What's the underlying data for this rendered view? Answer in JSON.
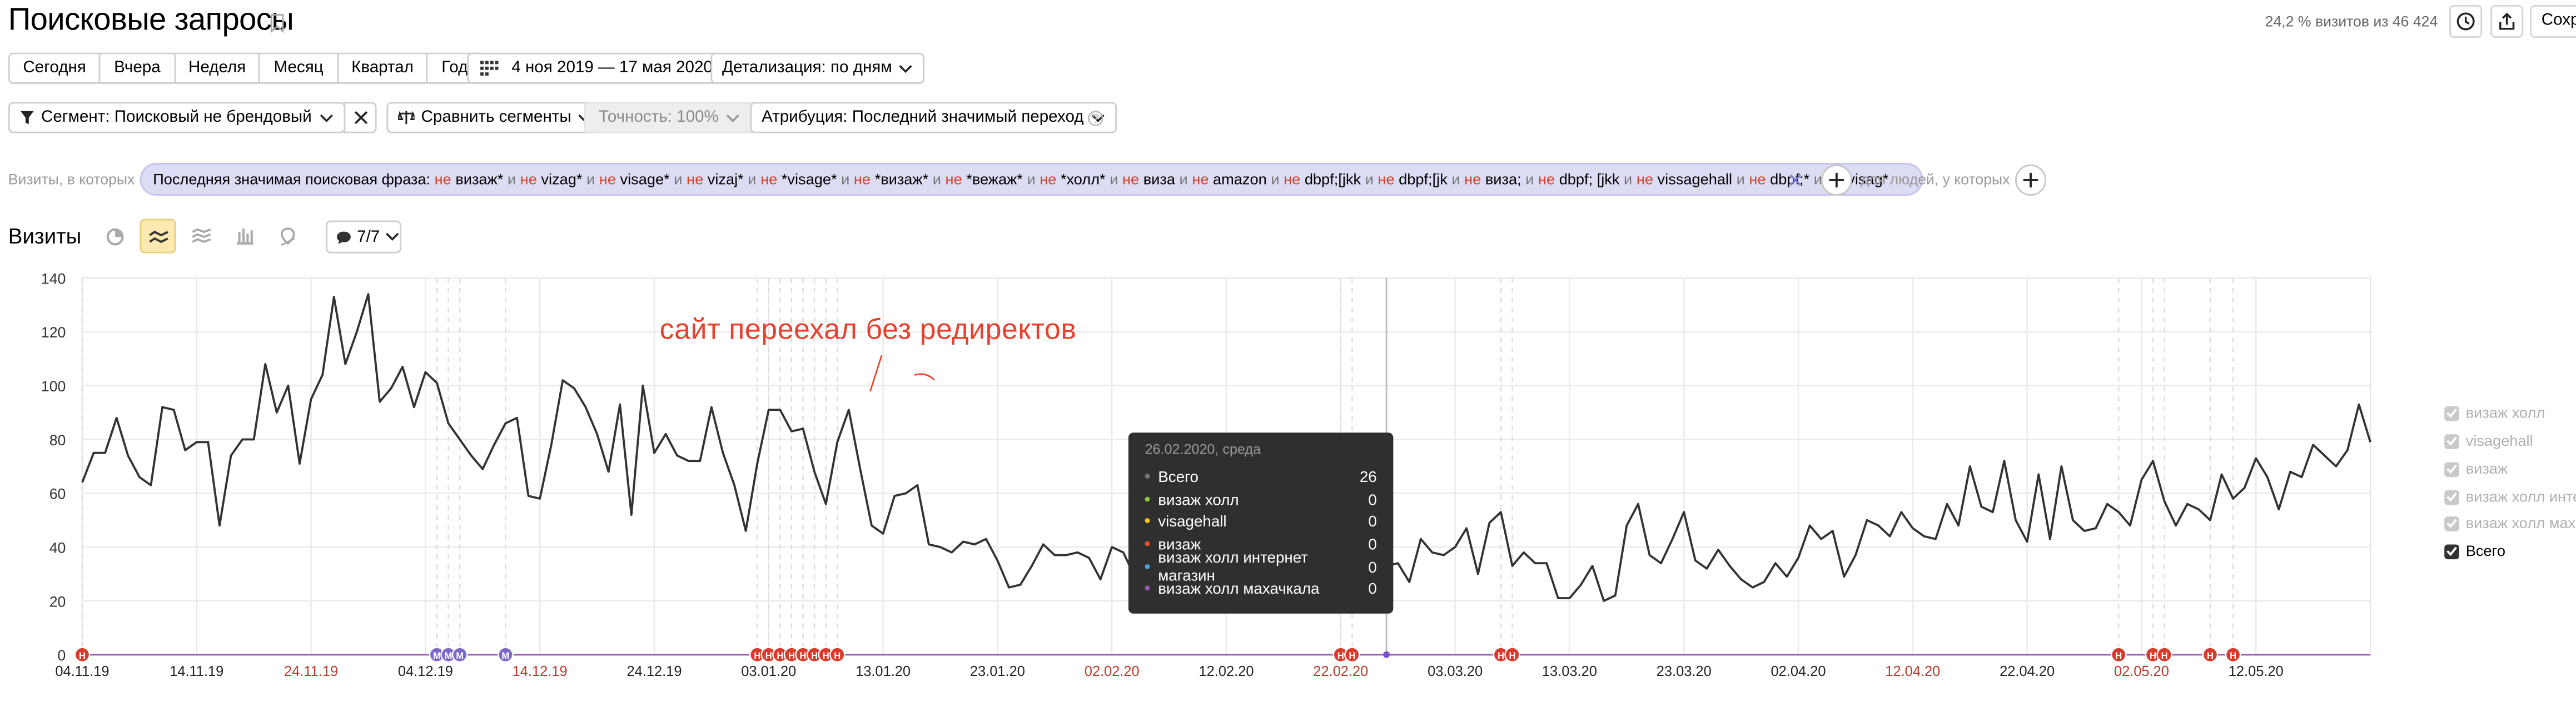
{
  "header": {
    "title": "Поисковые запросы",
    "visits_info": "24,2 % визитов из 46 424",
    "save_label": "Сохр"
  },
  "period": {
    "buttons": [
      "Сегодня",
      "Вчера",
      "Неделя",
      "Месяц",
      "Квартал",
      "Год"
    ],
    "date_range": "4 ноя 2019 — 17 мая 2020",
    "detail": "Детализация: по дням"
  },
  "filters": {
    "segment": "Сегмент: Поисковый не брендовый тр...",
    "compare": "Сравнить сегменты",
    "accuracy": "Точность: 100%",
    "attribution": "Атрибуция: Последний значимый переход"
  },
  "conditions": {
    "label": "Визиты, в которых",
    "people_label": "для людей, у которых",
    "pill_parts": [
      {
        "t": "Последняя значимая поисковая фраза: ",
        "c": ""
      },
      {
        "t": "не",
        "c": "n"
      },
      {
        "t": " визаж* ",
        "c": ""
      },
      {
        "t": "и",
        "c": "g"
      },
      {
        "t": " ",
        "c": ""
      },
      {
        "t": "не",
        "c": "n"
      },
      {
        "t": " vizag* ",
        "c": ""
      },
      {
        "t": "и",
        "c": "g"
      },
      {
        "t": " ",
        "c": ""
      },
      {
        "t": "не",
        "c": "n"
      },
      {
        "t": " visage* ",
        "c": ""
      },
      {
        "t": "и",
        "c": "g"
      },
      {
        "t": " ",
        "c": ""
      },
      {
        "t": "не",
        "c": "n"
      },
      {
        "t": " vizaj* ",
        "c": ""
      },
      {
        "t": "и",
        "c": "g"
      },
      {
        "t": " ",
        "c": ""
      },
      {
        "t": "не",
        "c": "n"
      },
      {
        "t": " *visage* ",
        "c": ""
      },
      {
        "t": "и",
        "c": "g"
      },
      {
        "t": " ",
        "c": ""
      },
      {
        "t": "не",
        "c": "n"
      },
      {
        "t": " *визаж* ",
        "c": ""
      },
      {
        "t": "и",
        "c": "g"
      },
      {
        "t": " ",
        "c": ""
      },
      {
        "t": "не",
        "c": "n"
      },
      {
        "t": " *вежаж* ",
        "c": ""
      },
      {
        "t": "и",
        "c": "g"
      },
      {
        "t": " ",
        "c": ""
      },
      {
        "t": "не",
        "c": "n"
      },
      {
        "t": " *холл* ",
        "c": ""
      },
      {
        "t": "и",
        "c": "g"
      },
      {
        "t": " ",
        "c": ""
      },
      {
        "t": "не",
        "c": "n"
      },
      {
        "t": " виза ",
        "c": ""
      },
      {
        "t": "и",
        "c": "g"
      },
      {
        "t": " ",
        "c": ""
      },
      {
        "t": "не",
        "c": "n"
      },
      {
        "t": " amazon ",
        "c": ""
      },
      {
        "t": "и",
        "c": "g"
      },
      {
        "t": " ",
        "c": ""
      },
      {
        "t": "не",
        "c": "n"
      },
      {
        "t": " dbpf;[jkk ",
        "c": ""
      },
      {
        "t": "и",
        "c": "g"
      },
      {
        "t": " ",
        "c": ""
      },
      {
        "t": "не",
        "c": "n"
      },
      {
        "t": " dbpf;[jk ",
        "c": ""
      },
      {
        "t": "и",
        "c": "g"
      },
      {
        "t": " ",
        "c": ""
      },
      {
        "t": "не",
        "c": "n"
      },
      {
        "t": " виза; ",
        "c": ""
      },
      {
        "t": "и",
        "c": "g"
      },
      {
        "t": " ",
        "c": ""
      },
      {
        "t": "не",
        "c": "n"
      },
      {
        "t": " dbpf; [jkk ",
        "c": ""
      },
      {
        "t": "и",
        "c": "g"
      },
      {
        "t": " ",
        "c": ""
      },
      {
        "t": "не",
        "c": "n"
      },
      {
        "t": " vissagehall ",
        "c": ""
      },
      {
        "t": "и",
        "c": "g"
      },
      {
        "t": " ",
        "c": ""
      },
      {
        "t": "не",
        "c": "n"
      },
      {
        "t": " dbpf;* ",
        "c": ""
      },
      {
        "t": "и",
        "c": "g"
      },
      {
        "t": " ",
        "c": ""
      },
      {
        "t": "не",
        "c": "n"
      },
      {
        "t": " visag*",
        "c": ""
      }
    ]
  },
  "chart_header": {
    "title": "Визиты",
    "notes_count": "7/7"
  },
  "annotation_text": "сайт переехал без редиректов",
  "tooltip": {
    "date": "26.02.2020, среда",
    "rows": [
      {
        "label": "Всего",
        "value": "26",
        "color": "#2b2b2b"
      },
      {
        "label": "визаж холл",
        "value": "0",
        "color": "#8cc63f"
      },
      {
        "label": "visagehall",
        "value": "0",
        "color": "#f5c518"
      },
      {
        "label": "визаж",
        "value": "0",
        "color": "#e8502c"
      },
      {
        "label": "визаж холл интернет магазин",
        "value": "0",
        "color": "#3fa9e0"
      },
      {
        "label": "визаж холл махачкала",
        "value": "0",
        "color": "#9b59b6"
      }
    ]
  },
  "legend": [
    {
      "label": "визаж холл",
      "checked": false
    },
    {
      "label": "visagehall",
      "checked": false
    },
    {
      "label": "визаж",
      "checked": false
    },
    {
      "label": "визаж холл инте",
      "checked": false
    },
    {
      "label": "визаж холл махa",
      "checked": false
    },
    {
      "label": "Всего",
      "checked": true
    }
  ],
  "chart_data": {
    "type": "line",
    "title": "",
    "xlabel": "",
    "ylabel": "",
    "ylim": [
      0,
      140
    ],
    "yticks": [
      0,
      20,
      40,
      60,
      80,
      100,
      120,
      140
    ],
    "grid": true,
    "x_start": "04.11.19",
    "x_end": "17.05.20",
    "xtick_labels": [
      {
        "label": "04.11.19",
        "index": 0,
        "weekend": false
      },
      {
        "label": "14.11.19",
        "index": 10,
        "weekend": false
      },
      {
        "label": "24.11.19",
        "index": 20,
        "weekend": true
      },
      {
        "label": "04.12.19",
        "index": 30,
        "weekend": false
      },
      {
        "label": "14.12.19",
        "index": 40,
        "weekend": true
      },
      {
        "label": "24.12.19",
        "index": 50,
        "weekend": false
      },
      {
        "label": "03.01.20",
        "index": 60,
        "weekend": false
      },
      {
        "label": "13.01.20",
        "index": 70,
        "weekend": false
      },
      {
        "label": "23.01.20",
        "index": 80,
        "weekend": false
      },
      {
        "label": "02.02.20",
        "index": 90,
        "weekend": true
      },
      {
        "label": "12.02.20",
        "index": 100,
        "weekend": false
      },
      {
        "label": "22.02.20",
        "index": 110,
        "weekend": true
      },
      {
        "label": "03.03.20",
        "index": 120,
        "weekend": false
      },
      {
        "label": "13.03.20",
        "index": 130,
        "weekend": false
      },
      {
        "label": "23.03.20",
        "index": 140,
        "weekend": false
      },
      {
        "label": "02.04.20",
        "index": 150,
        "weekend": false
      },
      {
        "label": "12.04.20",
        "index": 160,
        "weekend": true
      },
      {
        "label": "22.04.20",
        "index": 170,
        "weekend": false
      },
      {
        "label": "02.05.20",
        "index": 180,
        "weekend": true
      },
      {
        "label": "12.05.20",
        "index": 190,
        "weekend": false
      }
    ],
    "series": [
      {
        "name": "Всего",
        "color": "#333333",
        "values": [
          64,
          75,
          75,
          88,
          74,
          66,
          63,
          92,
          91,
          76,
          79,
          79,
          48,
          74,
          80,
          80,
          108,
          90,
          100,
          71,
          95,
          104,
          133,
          108,
          120,
          134,
          94,
          99,
          107,
          92,
          105,
          101,
          86,
          80,
          74,
          69,
          78,
          86,
          88,
          59,
          58,
          78,
          102,
          99,
          92,
          82,
          68,
          93,
          52,
          100,
          75,
          82,
          74,
          72,
          72,
          92,
          75,
          63,
          46,
          71,
          91,
          91,
          83,
          84,
          68,
          56,
          79,
          91,
          69,
          48,
          45,
          59,
          60,
          63,
          41,
          40,
          38,
          42,
          41,
          43,
          35,
          25,
          26,
          33,
          41,
          37,
          37,
          38,
          36,
          28,
          40,
          38,
          29,
          28,
          32,
          27,
          25,
          33,
          38,
          30,
          22,
          25,
          35,
          39,
          34,
          30,
          40,
          33,
          29,
          28,
          31,
          26,
          30,
          26,
          33,
          34,
          27,
          43,
          38,
          37,
          40,
          47,
          30,
          49,
          53,
          33,
          38,
          34,
          34,
          21,
          21,
          26,
          33,
          20,
          22,
          48,
          56,
          37,
          34,
          43,
          53,
          35,
          32,
          39,
          33,
          28,
          25,
          27,
          34,
          29,
          36,
          48,
          43,
          46,
          29,
          37,
          50,
          48,
          44,
          53,
          47,
          44,
          43,
          56,
          48,
          70,
          55,
          53,
          72,
          50,
          42,
          67,
          43,
          70,
          50,
          46,
          47,
          56,
          53,
          48,
          65,
          72,
          57,
          48,
          56,
          54,
          50,
          67,
          58,
          62,
          73,
          66,
          54,
          68,
          66,
          78,
          74,
          70,
          76,
          93,
          79
        ]
      }
    ],
    "annotation_markers": [
      {
        "index": 0,
        "color": "#d93a2b",
        "letter": "H"
      },
      {
        "index": 31,
        "color": "#7b68c9",
        "letter": "M"
      },
      {
        "index": 32,
        "color": "#7b68c9",
        "letter": "M"
      },
      {
        "index": 33,
        "color": "#7b68c9",
        "letter": "M"
      },
      {
        "index": 37,
        "color": "#7b68c9",
        "letter": "M"
      },
      {
        "index": 59,
        "color": "#d93a2b",
        "letter": "H"
      },
      {
        "index": 60,
        "color": "#d93a2b",
        "letter": "H"
      },
      {
        "index": 61,
        "color": "#d93a2b",
        "letter": "H"
      },
      {
        "index": 62,
        "color": "#d93a2b",
        "letter": "H"
      },
      {
        "index": 63,
        "color": "#d93a2b",
        "letter": "H"
      },
      {
        "index": 64,
        "color": "#d93a2b",
        "letter": "H"
      },
      {
        "index": 65,
        "color": "#d93a2b",
        "letter": "H"
      },
      {
        "index": 66,
        "color": "#d93a2b",
        "letter": "H"
      },
      {
        "index": 110,
        "color": "#d93a2b",
        "letter": "H"
      },
      {
        "index": 111,
        "color": "#d93a2b",
        "letter": "H"
      },
      {
        "index": 124,
        "color": "#d93a2b",
        "letter": "H"
      },
      {
        "index": 125,
        "color": "#d93a2b",
        "letter": "H"
      },
      {
        "index": 178,
        "color": "#d93a2b",
        "letter": "H"
      },
      {
        "index": 181,
        "color": "#d93a2b",
        "letter": "H"
      },
      {
        "index": 182,
        "color": "#d93a2b",
        "letter": "H"
      },
      {
        "index": 186,
        "color": "#d93a2b",
        "letter": "H"
      },
      {
        "index": 188,
        "color": "#d93a2b",
        "letter": "H"
      }
    ],
    "highlighted_index": 114
  }
}
